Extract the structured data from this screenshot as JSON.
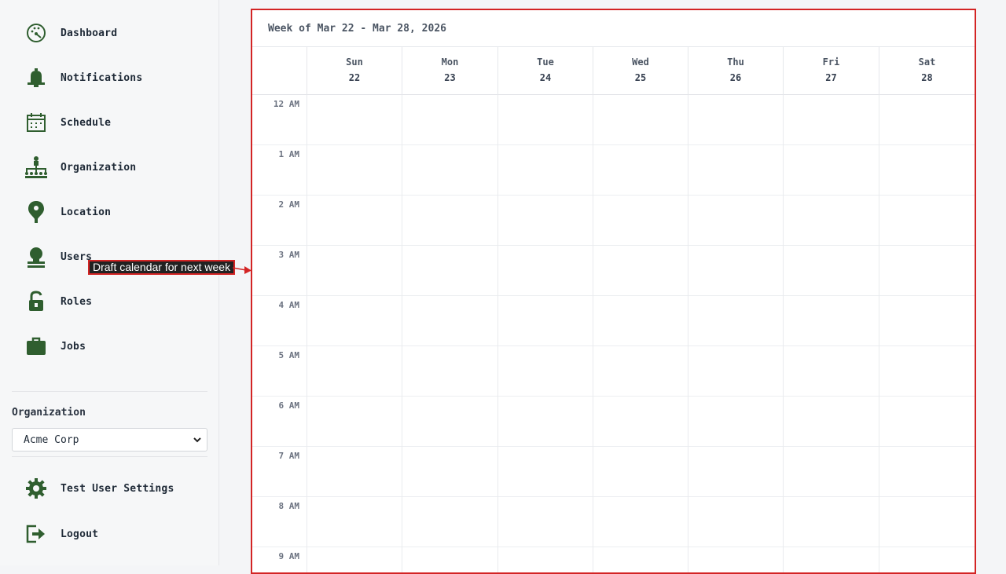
{
  "sidebar": {
    "nav_items": [
      {
        "label": "Dashboard",
        "icon": "dashboard-icon"
      },
      {
        "label": "Notifications",
        "icon": "bell-icon"
      },
      {
        "label": "Schedule",
        "icon": "calendar-icon"
      },
      {
        "label": "Organization",
        "icon": "org-chart-icon"
      },
      {
        "label": "Location",
        "icon": "map-pin-icon"
      },
      {
        "label": "Users",
        "icon": "user-icon"
      },
      {
        "label": "Roles",
        "icon": "lock-icon"
      },
      {
        "label": "Jobs",
        "icon": "briefcase-icon"
      }
    ],
    "organization_label": "Organization",
    "organization_selected": "Acme Corp",
    "settings_label": "Test User Settings",
    "logout_label": "Logout"
  },
  "annotation": {
    "text": "Draft calendar for next week"
  },
  "calendar": {
    "title": "Week of Mar 22 - Mar 28, 2026",
    "days": [
      {
        "name": "Sun",
        "date": "22"
      },
      {
        "name": "Mon",
        "date": "23"
      },
      {
        "name": "Tue",
        "date": "24"
      },
      {
        "name": "Wed",
        "date": "25"
      },
      {
        "name": "Thu",
        "date": "26"
      },
      {
        "name": "Fri",
        "date": "27"
      },
      {
        "name": "Sat",
        "date": "28"
      }
    ],
    "hours": [
      "12 AM",
      "1 AM",
      "2 AM",
      "3 AM",
      "4 AM",
      "5 AM",
      "6 AM",
      "7 AM",
      "8 AM",
      "9 AM"
    ]
  },
  "colors": {
    "icon_green": "#2f5e2f",
    "accent_red": "#d32424"
  }
}
